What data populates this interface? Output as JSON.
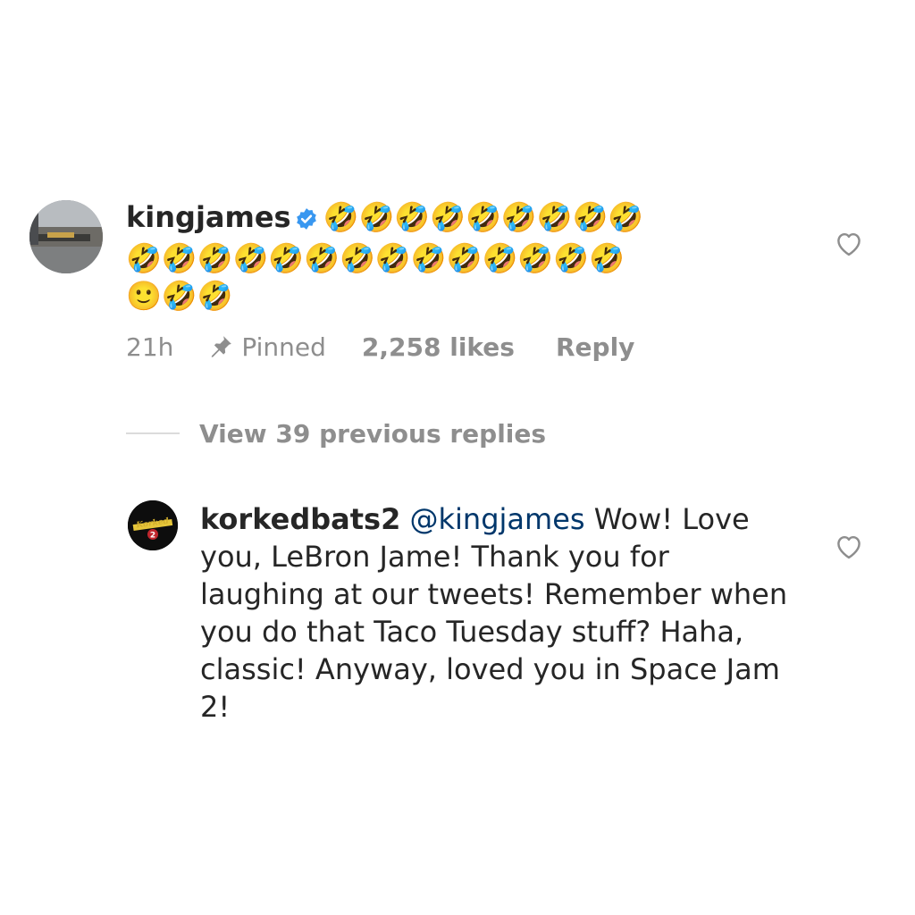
{
  "comment_1": {
    "username": "kingjames",
    "verified_icon": "verified-badge-icon",
    "emojis_line1": "🤣🤣🤣🤣🤣🤣🤣🤣🤣",
    "emojis_line2": "🤣🤣🤣🤣🤣🤣🤣🤣🤣🤣🤣🤣🤣🤣",
    "emojis_line3": "🙂🤣🤣",
    "time": "21h",
    "pinned_label": "Pinned",
    "likes": "2,258 likes",
    "reply_label": "Reply",
    "like_icon": "heart-outline-icon"
  },
  "view_replies": {
    "label": "View 39 previous replies"
  },
  "comment_2": {
    "username": "korkedbats2",
    "mention": "@kingjames",
    "text": " Wow! Love you, LeBron Jame! Thank you for laughing at our tweets! Remember when you do that Taco Tuesday stuff? Haha, classic! Anyway, loved you in Space Jam 2!",
    "like_icon": "heart-outline-icon"
  },
  "colors": {
    "text": "#262626",
    "muted": "#8e8e8e",
    "mention": "#00376b",
    "verified": "#3897f0"
  }
}
